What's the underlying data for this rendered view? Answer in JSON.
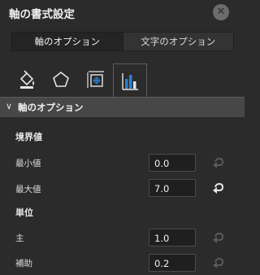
{
  "panel": {
    "title": "軸の書式設定",
    "close_icon": "✕"
  },
  "segment_tabs": [
    {
      "label": "軸のオプション",
      "active": true
    },
    {
      "label": "文字のオプション",
      "active": false
    }
  ],
  "icon_tabs": [
    {
      "icon": "fill-line-icon",
      "active": false
    },
    {
      "icon": "effects-pentagon-icon",
      "active": false
    },
    {
      "icon": "size-properties-icon",
      "active": false
    },
    {
      "icon": "axis-options-icon",
      "active": true
    }
  ],
  "section": {
    "chevron": "∨",
    "title": "軸のオプション"
  },
  "bounds": {
    "title": "境界値",
    "min": {
      "label": "最小値",
      "value": "0.0",
      "reset_enabled": false
    },
    "max": {
      "label": "最大値",
      "value": "7.0",
      "reset_enabled": true
    }
  },
  "units": {
    "title": "単位",
    "major": {
      "label": "主",
      "value": "1.0",
      "reset_enabled": false
    },
    "minor": {
      "label": "補助",
      "value": "0.2",
      "reset_enabled": false
    }
  },
  "colors": {
    "accent": "#2f7fd0",
    "background": "#2b2b2b"
  }
}
